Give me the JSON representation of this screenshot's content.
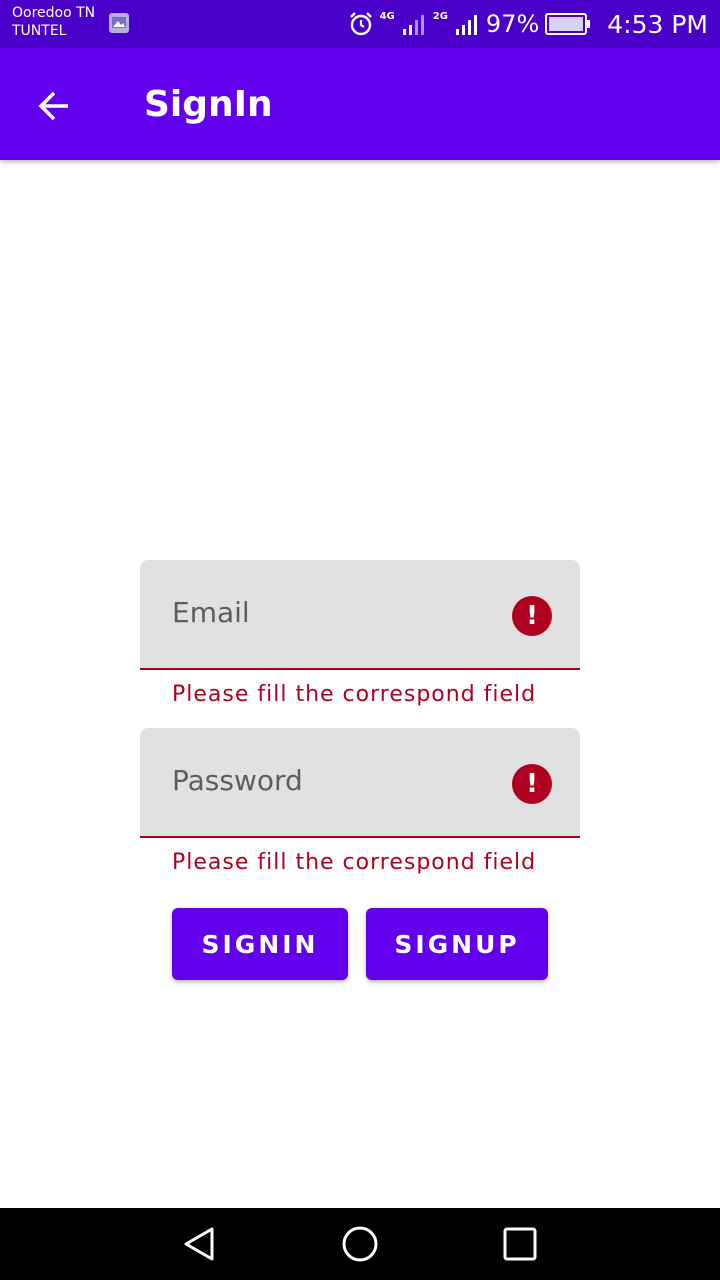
{
  "status_bar": {
    "carrier_line1": "Ooredoo TN",
    "carrier_line2": "TUNTEL",
    "net1": "4G",
    "net2": "2G",
    "battery": "97%",
    "time": "4:53 PM"
  },
  "app_bar": {
    "title": "SignIn",
    "background": "#6200ee"
  },
  "form": {
    "email_placeholder": "Email",
    "email_error": "Please fill the correspond field",
    "password_placeholder": "Password",
    "password_error": "Please fill the correspond field",
    "error_color": "#b00020"
  },
  "buttons": {
    "signin": "SIGNIN",
    "signup": "SIGNUP"
  },
  "nav_bar": {
    "back": "back-icon",
    "home": "home-icon",
    "recents": "recents-icon"
  }
}
